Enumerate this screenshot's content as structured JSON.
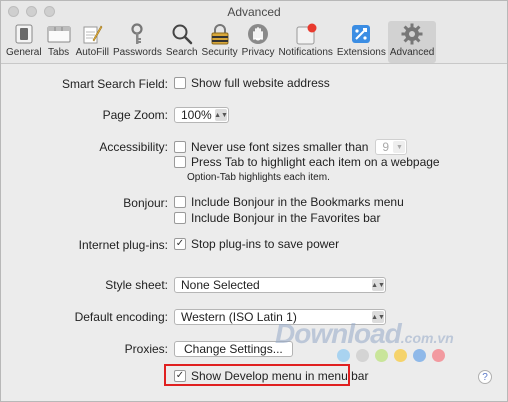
{
  "window": {
    "title": "Advanced"
  },
  "toolbar": [
    {
      "label": "General",
      "icon": "general-icon"
    },
    {
      "label": "Tabs",
      "icon": "tabs-icon"
    },
    {
      "label": "AutoFill",
      "icon": "autofill-icon"
    },
    {
      "label": "Passwords",
      "icon": "passwords-key-icon"
    },
    {
      "label": "Search",
      "icon": "search-icon"
    },
    {
      "label": "Security",
      "icon": "security-lock-icon"
    },
    {
      "label": "Privacy",
      "icon": "privacy-hand-icon"
    },
    {
      "label": "Notifications",
      "icon": "notifications-icon"
    },
    {
      "label": "Extensions",
      "icon": "extensions-icon"
    },
    {
      "label": "Advanced",
      "icon": "advanced-gear-icon",
      "selected": true
    }
  ],
  "settings": {
    "smart_search": {
      "label": "Smart Search Field:",
      "option": "Show full website address",
      "checked": false
    },
    "page_zoom": {
      "label": "Page Zoom:",
      "value": "100%"
    },
    "accessibility": {
      "label": "Accessibility:",
      "font_option": "Never use font sizes smaller than",
      "font_checked": false,
      "font_size": "9",
      "tab_option": "Press Tab to highlight each item on a webpage",
      "tab_checked": false,
      "tab_note": "Option-Tab highlights each item."
    },
    "bonjour": {
      "label": "Bonjour:",
      "bookmarks_option": "Include Bonjour in the Bookmarks menu",
      "bookmarks_checked": false,
      "favorites_option": "Include Bonjour in the Favorites bar",
      "favorites_checked": false
    },
    "plugins": {
      "label": "Internet plug-ins:",
      "option": "Stop plug-ins to save power",
      "checked": true
    },
    "style_sheet": {
      "label": "Style sheet:",
      "value": "None Selected"
    },
    "encoding": {
      "label": "Default encoding:",
      "value": "Western (ISO Latin 1)"
    },
    "proxies": {
      "label": "Proxies:",
      "button": "Change Settings..."
    },
    "develop": {
      "option": "Show Develop menu in menu bar",
      "checked": true
    }
  },
  "help": {
    "label": "?"
  },
  "watermark": {
    "text": "Download",
    "suffix": ".com.vn"
  },
  "colors": {
    "highlight": "#e02020",
    "dots": [
      "#a9d3f0",
      "#d4d4d4",
      "#c9e59a",
      "#f5d36b",
      "#8fb9e9",
      "#f29aa0"
    ]
  }
}
